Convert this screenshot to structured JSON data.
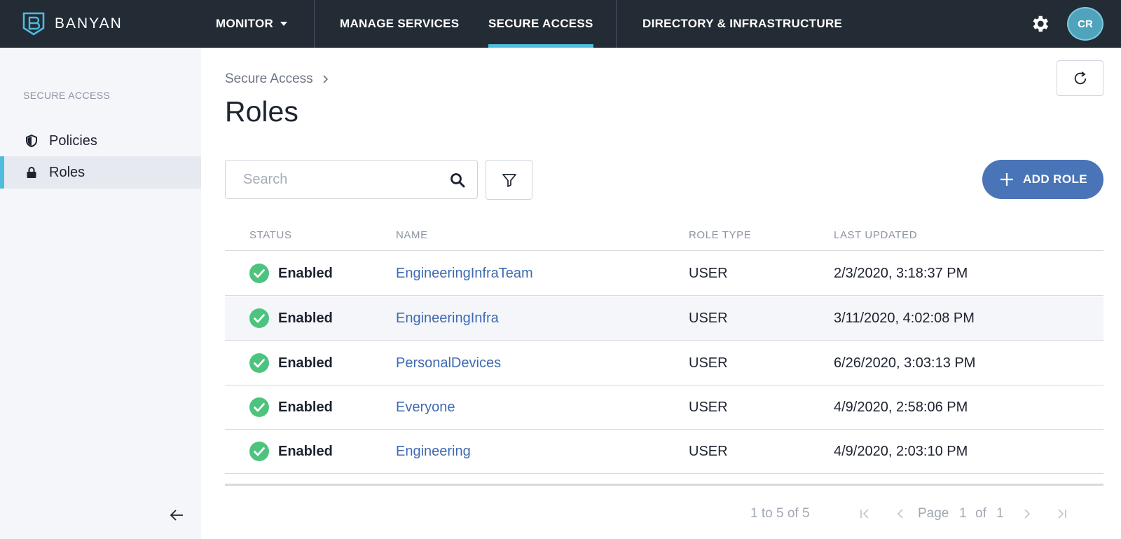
{
  "brand": {
    "name": "BANYAN"
  },
  "nav": {
    "monitor": "MONITOR",
    "manage_services": "MANAGE SERVICES",
    "secure_access": "SECURE ACCESS",
    "directory": "DIRECTORY & INFRASTRUCTURE",
    "avatar_initials": "CR"
  },
  "sidebar": {
    "heading": "SECURE ACCESS",
    "items": [
      {
        "label": "Policies",
        "icon": "shield-icon",
        "selected": false
      },
      {
        "label": "Roles",
        "icon": "lock-icon",
        "selected": true
      }
    ]
  },
  "breadcrumb": {
    "parent": "Secure Access"
  },
  "page": {
    "title": "Roles"
  },
  "search": {
    "placeholder": "Search",
    "value": ""
  },
  "actions": {
    "add_role": "ADD ROLE"
  },
  "table": {
    "columns": [
      "STATUS",
      "NAME",
      "ROLE TYPE",
      "LAST UPDATED"
    ],
    "rows": [
      {
        "status": "Enabled",
        "name": "EngineeringInfraTeam",
        "role_type": "USER",
        "last_updated": "2/3/2020, 3:18:37 PM"
      },
      {
        "status": "Enabled",
        "name": "EngineeringInfra",
        "role_type": "USER",
        "last_updated": "3/11/2020, 4:02:08 PM"
      },
      {
        "status": "Enabled",
        "name": "PersonalDevices",
        "role_type": "USER",
        "last_updated": "6/26/2020, 3:03:13 PM"
      },
      {
        "status": "Enabled",
        "name": "Everyone",
        "role_type": "USER",
        "last_updated": "4/9/2020, 2:58:06 PM"
      },
      {
        "status": "Enabled",
        "name": "Engineering",
        "role_type": "USER",
        "last_updated": "4/9/2020, 2:03:10 PM"
      }
    ]
  },
  "pagination": {
    "range": "1 to 5 of 5",
    "page_label": "Page",
    "current": "1",
    "of_label": "of",
    "total": "1"
  },
  "colors": {
    "topbar": "#232b35",
    "accent": "#4dbcdd",
    "primary_button": "#4a74b8",
    "link": "#3f6ab2",
    "enabled": "#4cc47e"
  }
}
